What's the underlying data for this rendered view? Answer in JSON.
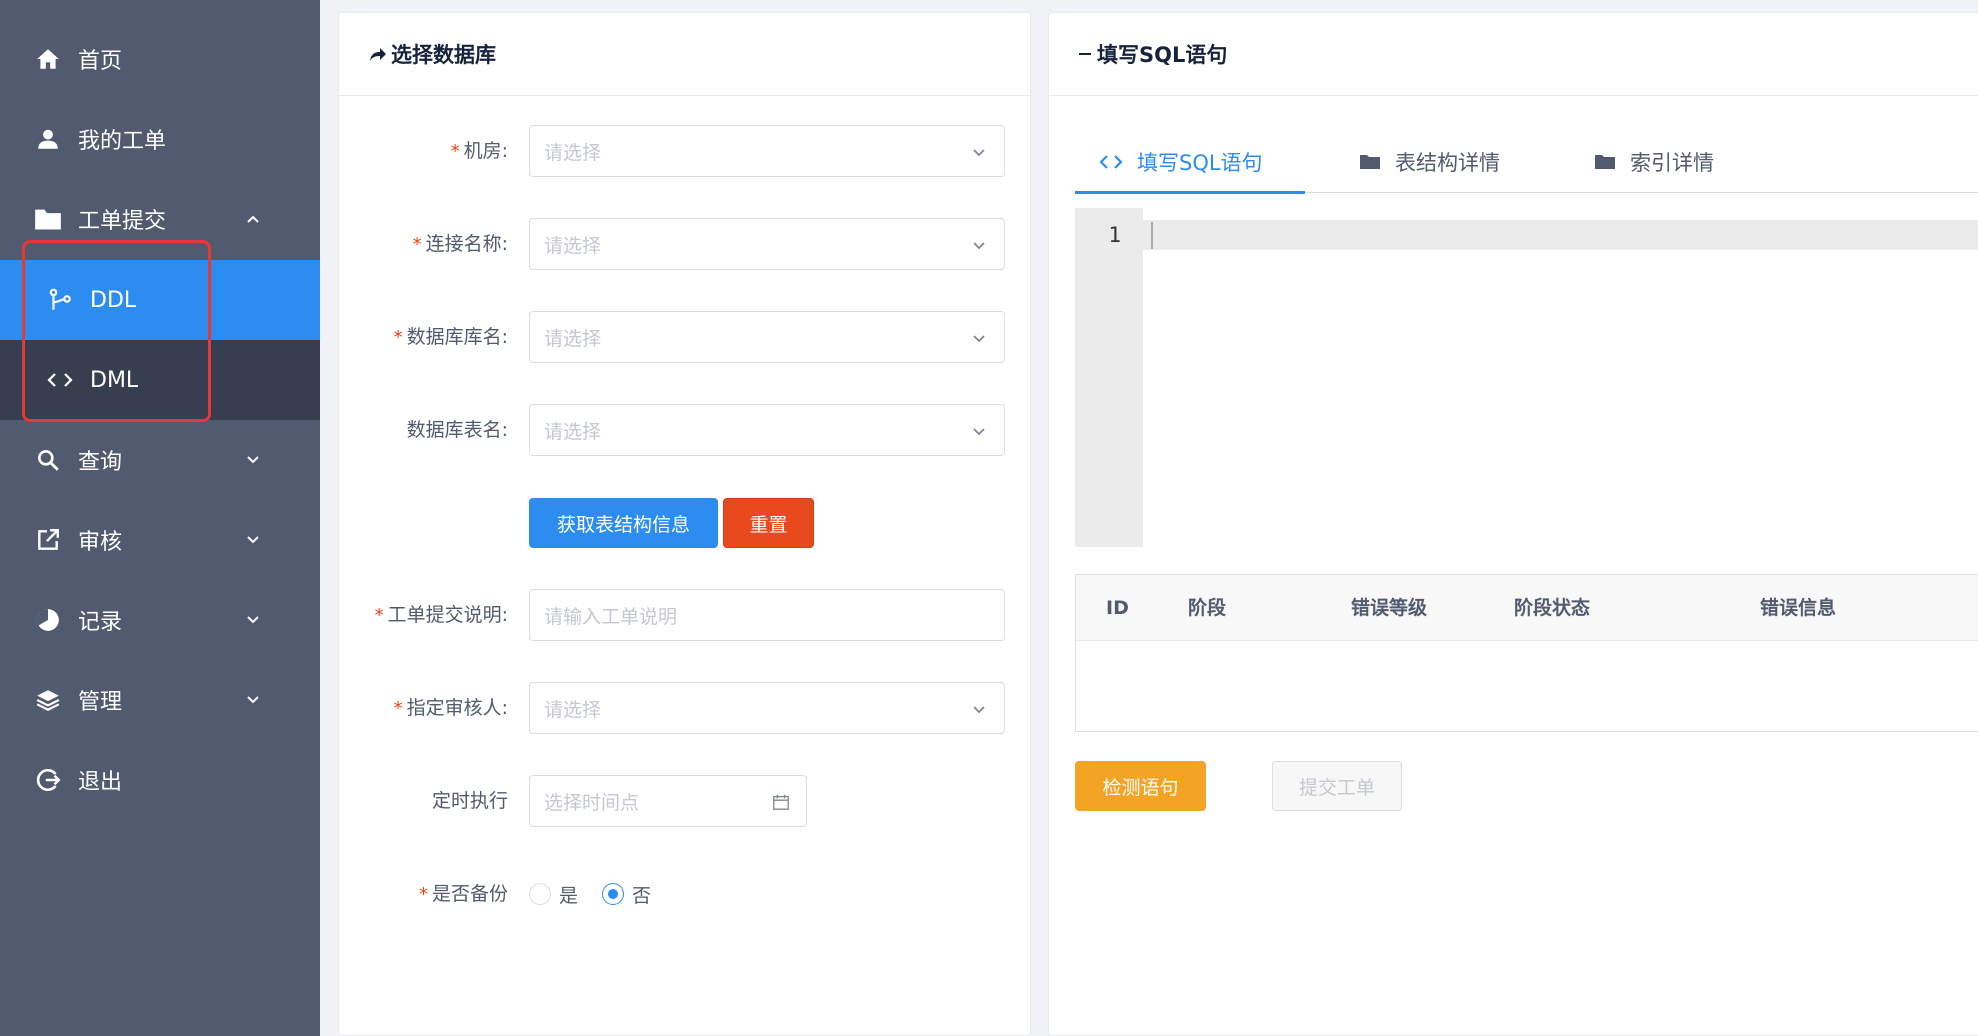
{
  "sidebar": {
    "items": [
      {
        "label": "首页",
        "icon": "home-icon"
      },
      {
        "label": "我的工单",
        "icon": "user-icon"
      },
      {
        "label": "工单提交",
        "icon": "folder-icon",
        "expanded": true
      },
      {
        "label": "查询",
        "icon": "search-icon"
      },
      {
        "label": "审核",
        "icon": "external-link-icon"
      },
      {
        "label": "记录",
        "icon": "pie-chart-icon"
      },
      {
        "label": "管理",
        "icon": "layers-icon"
      },
      {
        "label": "退出",
        "icon": "logout-icon"
      }
    ],
    "submenu": [
      {
        "label": "DDL",
        "icon": "fork-icon",
        "active": true
      },
      {
        "label": "DML",
        "icon": "code-icon",
        "active": false
      }
    ]
  },
  "left_panel": {
    "title": "选择数据库",
    "fields": {
      "room": {
        "label": "机房:",
        "placeholder": "请选择",
        "required": true
      },
      "connection": {
        "label": "连接名称:",
        "placeholder": "请选择",
        "required": true
      },
      "database": {
        "label": "数据库库名:",
        "placeholder": "请选择",
        "required": true
      },
      "table": {
        "label": "数据库表名:",
        "placeholder": "请选择",
        "required": false
      },
      "description": {
        "label": "工单提交说明:",
        "placeholder": "请输入工单说明",
        "required": true
      },
      "reviewer": {
        "label": "指定审核人:",
        "placeholder": "请选择",
        "required": true
      },
      "schedule": {
        "label": "定时执行",
        "placeholder": "选择时间点",
        "required": false
      },
      "backup": {
        "label": "是否备份",
        "required": true,
        "options": [
          "是",
          "否"
        ],
        "selected": "否"
      }
    },
    "buttons": {
      "fetch_structure": "获取表结构信息",
      "reset": "重置"
    }
  },
  "right_panel": {
    "title": "填写SQL语句",
    "tabs": [
      {
        "label": "填写SQL语句",
        "icon": "code-icon",
        "active": true
      },
      {
        "label": "表结构详情",
        "icon": "folder-icon",
        "active": false
      },
      {
        "label": "索引详情",
        "icon": "folder-icon",
        "active": false
      }
    ],
    "editor": {
      "line_numbers": [
        "1"
      ],
      "content": ""
    },
    "table": {
      "columns": [
        "ID",
        "阶段",
        "错误等级",
        "阶段状态",
        "错误信息"
      ],
      "rows": []
    },
    "buttons": {
      "check": "检测语句",
      "submit": "提交工单"
    }
  },
  "colors": {
    "sidebar_bg": "#515a6e",
    "submenu_bg": "#363e4f",
    "primary": "#2d8cf0",
    "danger": "#e8491d",
    "warning": "#f4a425",
    "highlight": "#e53935"
  }
}
